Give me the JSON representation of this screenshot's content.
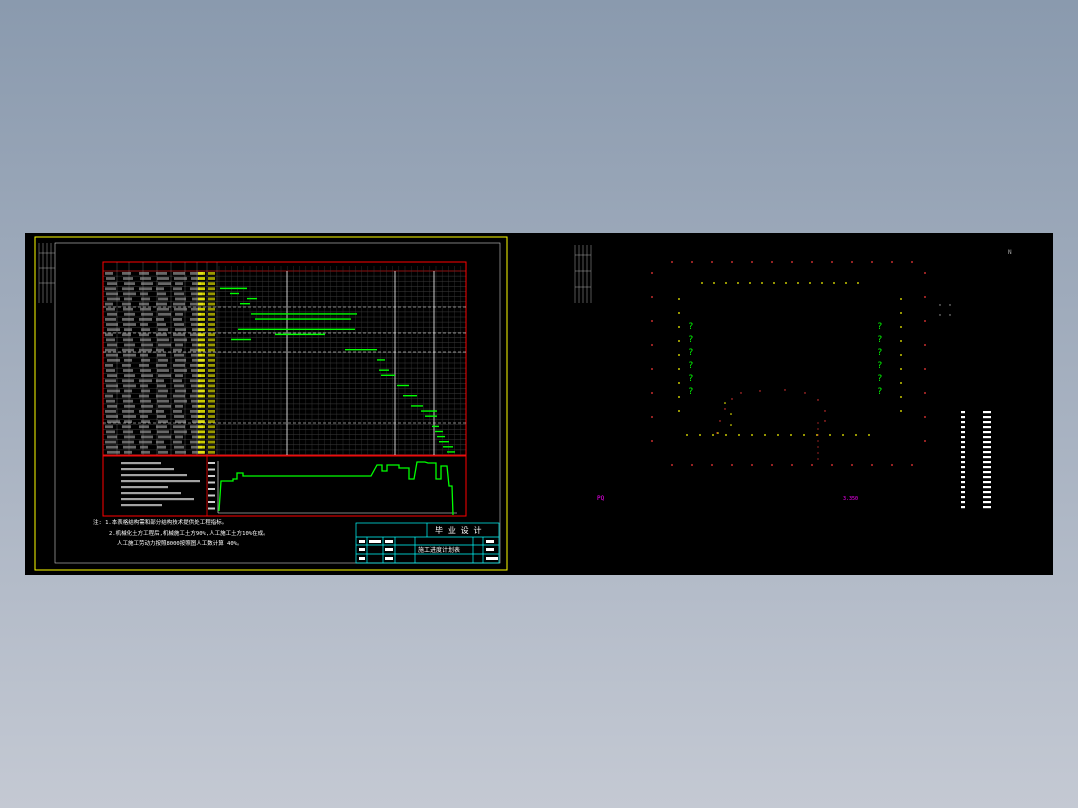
{
  "colors": {
    "background_top": "#8a9aae",
    "background_bottom": "#c4c9d3",
    "model_space": "#000000",
    "frame_yellow": "#ffff00",
    "line_red": "#ff0000",
    "bar_green": "#00ff00",
    "title_cyan": "#00ffff",
    "text_white": "#ffffff",
    "accent_magenta": "#ff00ff"
  },
  "sheet_left": {
    "notes": [
      "注: 1.本表格结构需和部分结构技术提供处工程指标。",
      "2.机械化土方工程后,机械施工土方90%,人工施工土方10%在成。",
      "人工施工劳动力按照8000按照图人工数计算 40%。"
    ]
  },
  "title_block": {
    "header": "毕 业 设 计",
    "drawing_name": "施工进度计划表"
  },
  "sheet_right": {
    "question_marks": [
      "?",
      "?",
      "?",
      "?",
      "?",
      "?"
    ],
    "label_left": "PQ",
    "label_center": "3.350",
    "corner_mark": "N"
  },
  "icons": {
    "viewport": "cad-model-space",
    "gantt": "gantt-chart",
    "histogram": "labor-histogram-chart",
    "site_plan": "site-layout-plan"
  }
}
